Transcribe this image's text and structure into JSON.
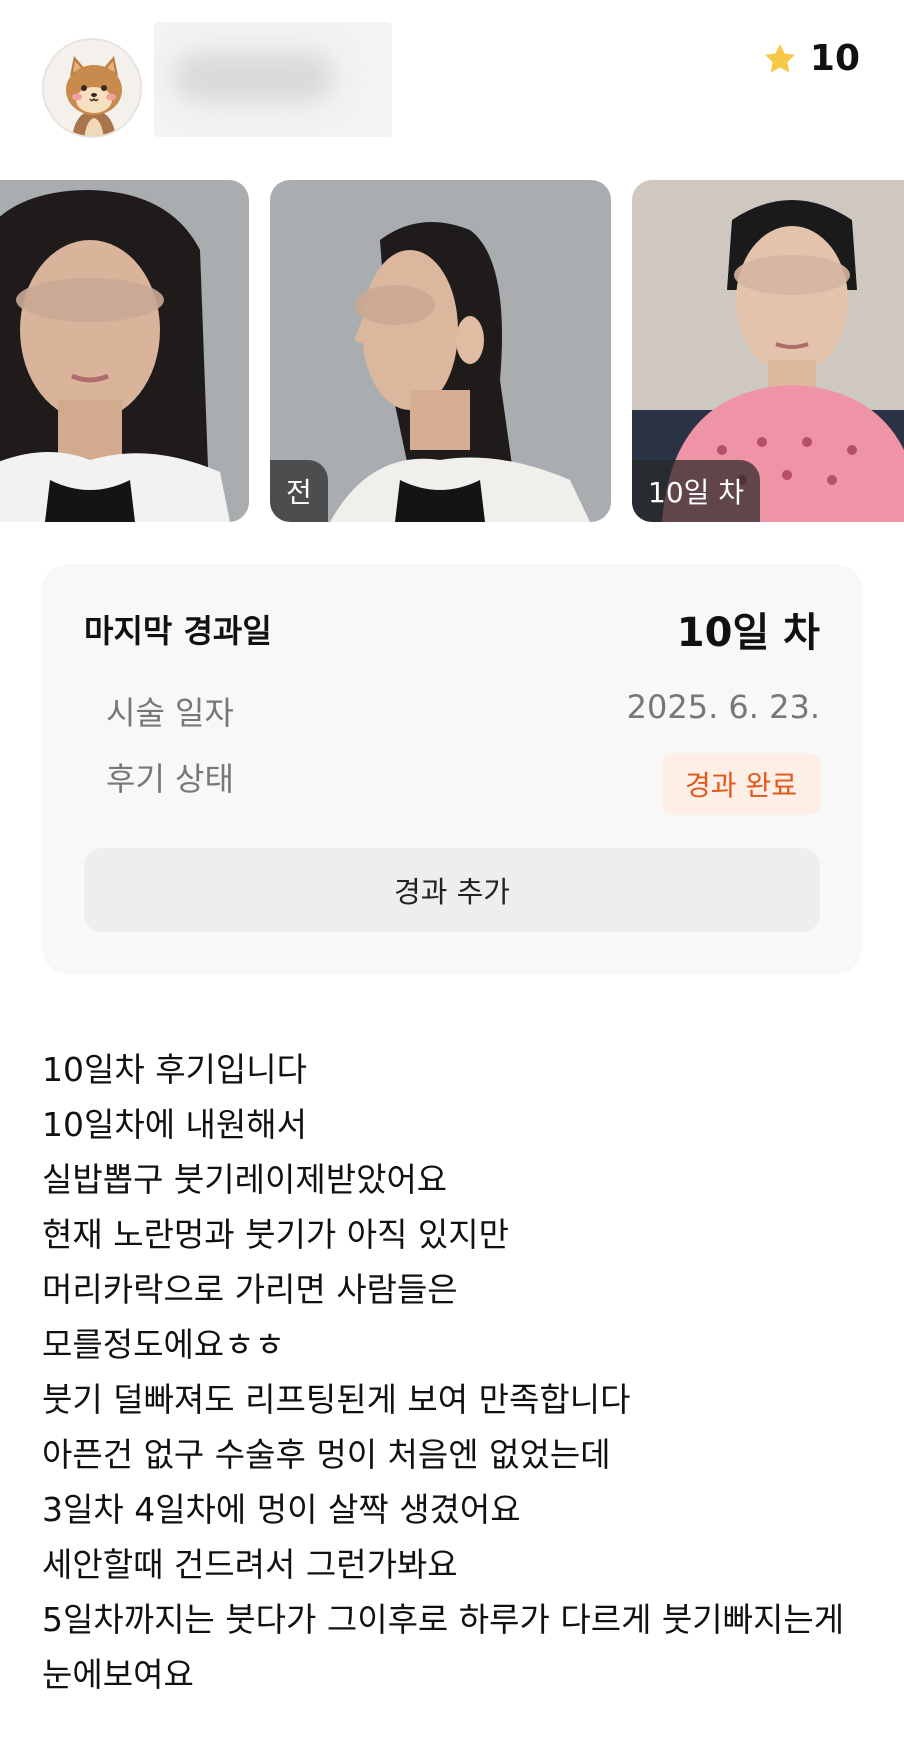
{
  "header": {
    "avatar_icon": "squirrel-avatar-icon",
    "rating_icon": "star-icon",
    "rating_color": "#F7C948",
    "rating_value": "10"
  },
  "photos": [
    {
      "tag": ""
    },
    {
      "tag": "전"
    },
    {
      "tag": "10일 차"
    }
  ],
  "summary": {
    "last_label": "마지막 경과일",
    "last_value": "10일 차",
    "procedure_date_label": "시술 일자",
    "procedure_date_value": "2025. 6. 23.",
    "status_label": "후기 상태",
    "status_value": "경과 완료",
    "status_color": "#E2581C",
    "add_button": "경과 추가"
  },
  "review": {
    "lines": [
      "10일차 후기입니다",
      "10일차에 내원해서",
      "실밥뽑구 붓기레이제받았어요",
      "현재 노란멍과 붓기가 아직 있지만",
      "머리카락으로 가리면 사람들은",
      "모를정도에요ㅎㅎ",
      "붓기 덜빠져도 리프팅된게 보여 만족합니다",
      "아픈건 없구 수술후 멍이 처음엔 없었는데",
      "3일차 4일차에 멍이 살짝 생겼어요",
      "세안할때 건드려서 그런가봐요",
      "5일차까지는 붓다가 그이후로 하루가 다르게 붓기빠지는게",
      "눈에보여요"
    ]
  }
}
